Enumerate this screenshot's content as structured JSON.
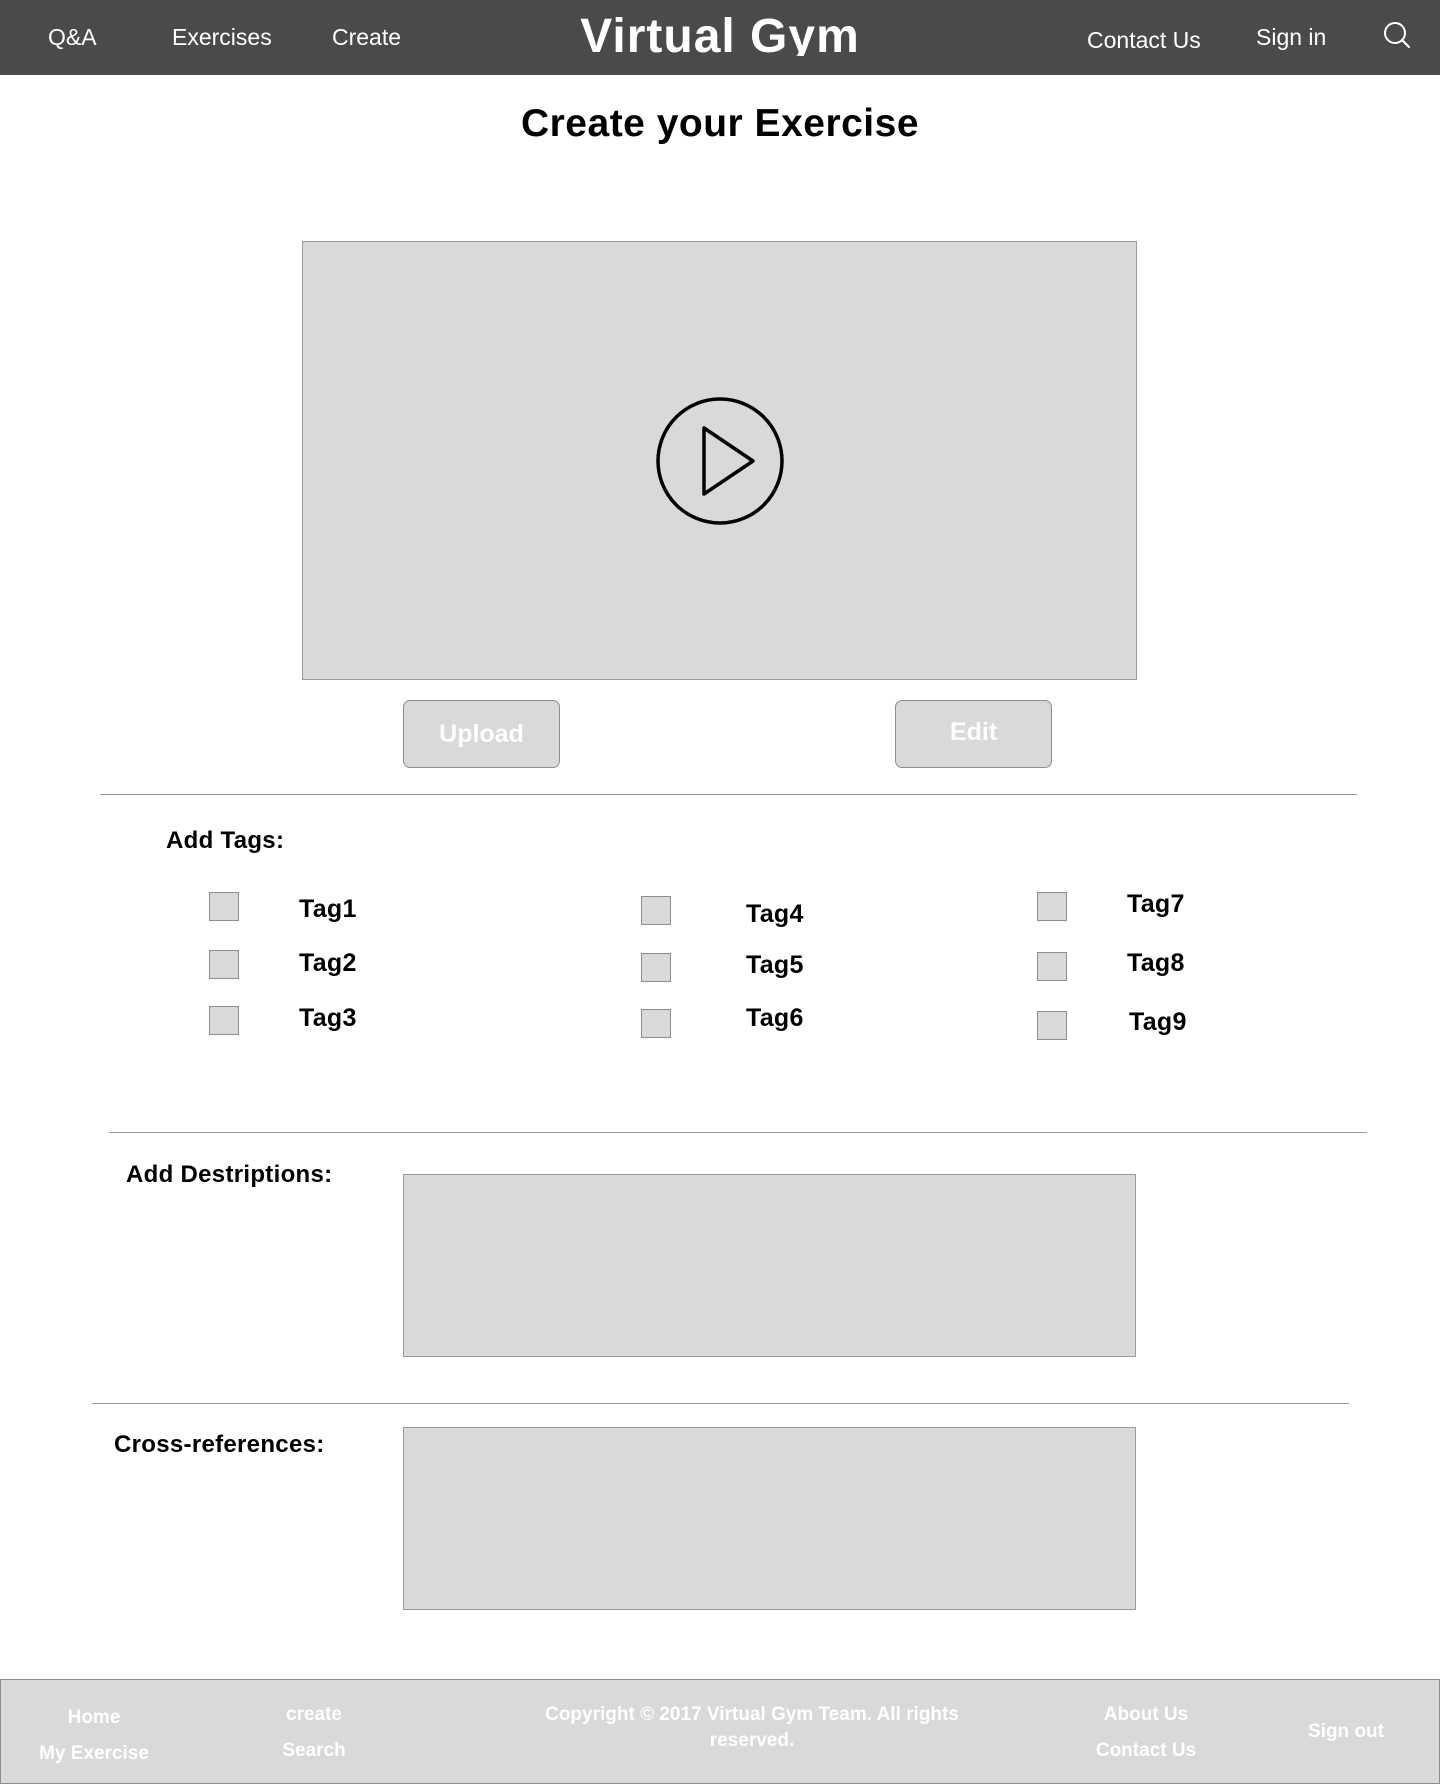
{
  "header": {
    "brand": "Virtual Gym",
    "nav_left": [
      "Q&A",
      "Exercises",
      "Create"
    ],
    "nav_right": [
      "Contact Us",
      "Sign in"
    ],
    "search_icon": "search-icon"
  },
  "page": {
    "title": "Create your Exercise"
  },
  "video": {
    "play_icon": "play-circle-icon",
    "upload_label": "Upload",
    "edit_label": "Edit"
  },
  "tags": {
    "label": "Add Tags:",
    "items": [
      "Tag1",
      "Tag2",
      "Tag3",
      "Tag4",
      "Tag5",
      "Tag6",
      "Tag7",
      "Tag8",
      "Tag9"
    ]
  },
  "descriptions": {
    "label": "Add Destriptions:"
  },
  "cross_references": {
    "label": "Cross-references:"
  },
  "footer": {
    "col1": [
      "Home",
      "My Exercise"
    ],
    "col2": [
      "create",
      "Search"
    ],
    "copyright": "Copyright © 2017 Virtual Gym Team. All rights reserved.",
    "col4": [
      "About Us",
      "Contact Us"
    ],
    "sign_out": "Sign out"
  },
  "colors": {
    "header_bg": "#4a4a4a",
    "placeholder_gray": "#d9d9d9",
    "border_gray": "#9a9a9a"
  }
}
